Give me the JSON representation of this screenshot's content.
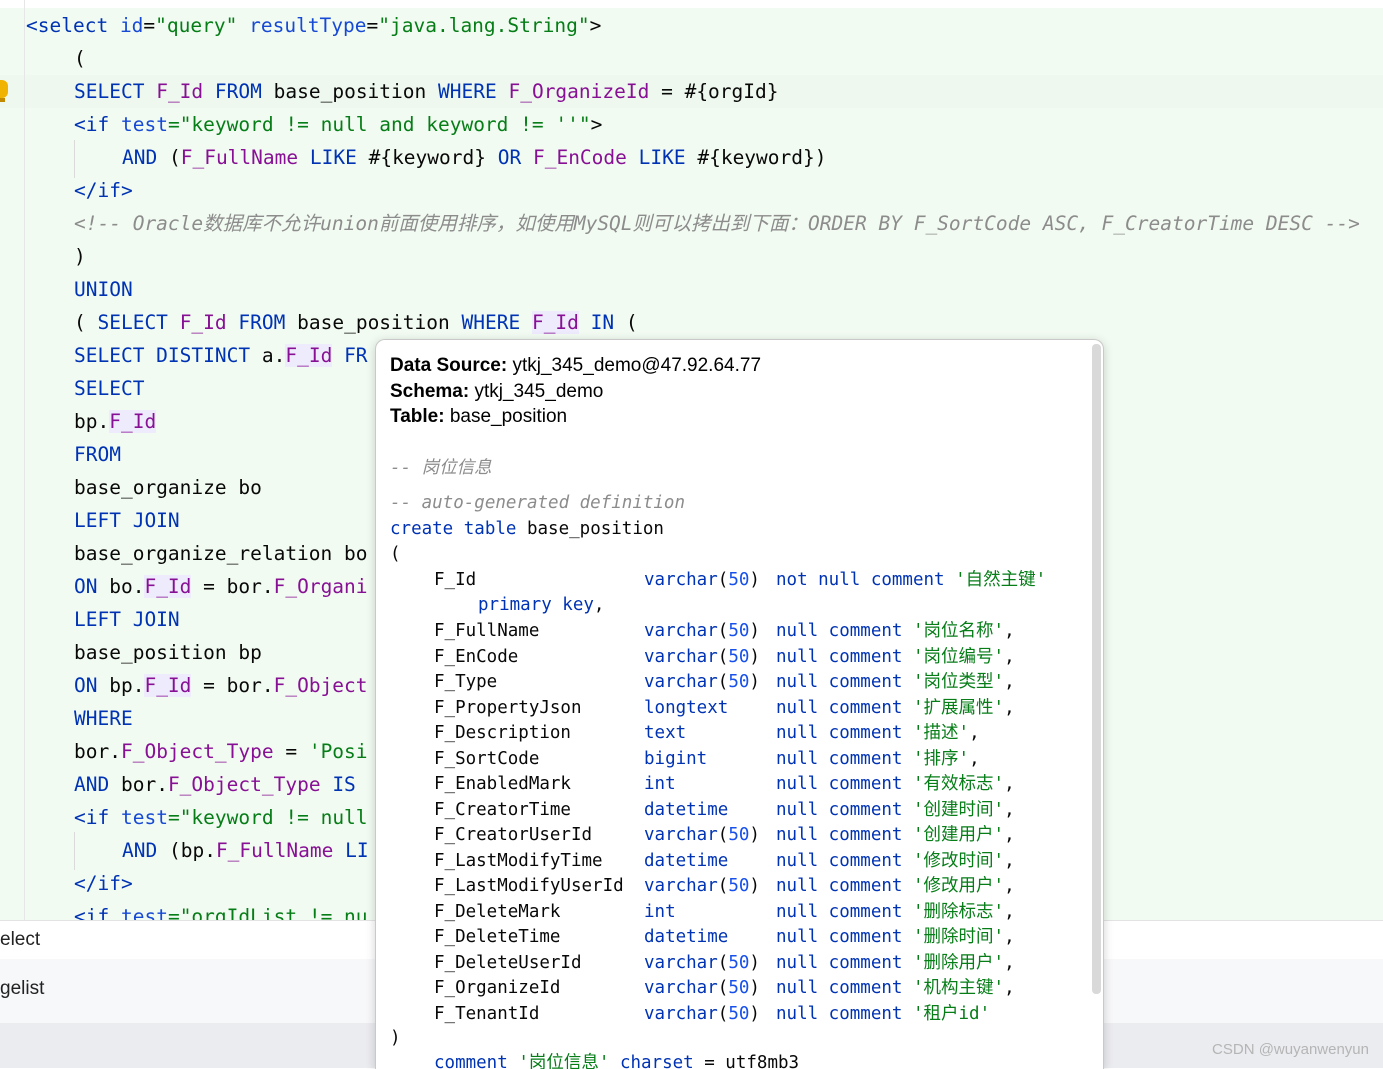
{
  "editor": {
    "line1": {
      "tag_open": "<select",
      "attr_id": "id",
      "val_id": "\"query\"",
      "attr_rt": "resultType",
      "val_rt": "\"java.lang.String\"",
      "tag_close": ">"
    },
    "line2": "(",
    "line3": {
      "kw1": "SELECT",
      "col1": "F_Id",
      "kw2": "FROM",
      "tbl": "base_position",
      "kw3": "WHERE",
      "col2": "F_OrganizeId",
      "rest": " = #{orgId}"
    },
    "line4": {
      "open": "<if",
      "attr": "test",
      "val": "=\"keyword != null and keyword != ''\"",
      "close": ">"
    },
    "line5": {
      "kw1": "AND",
      "p1": " (",
      "col1": "F_FullName",
      "kw2": "LIKE",
      "p2": " #{keyword} ",
      "kw3": "OR",
      "col2": "F_EnCode",
      "kw4": "LIKE",
      "p3": " #{keyword})"
    },
    "line6": "</if>",
    "line7": "<!-- Oracle数据库不允许union前面使用排序，如使用MySQL则可以拷出到下面：ORDER BY F_SortCode ASC, F_CreatorTime DESC -->",
    "line8": ")",
    "line9": "UNION",
    "line10": {
      "p1": "( ",
      "kw1": "SELECT",
      "col1": "F_Id",
      "kw2": "FROM",
      "tbl": "base_position",
      "kw3": "WHERE",
      "col2": "F_Id",
      "kw4": "IN",
      "p2": " ("
    },
    "line11": {
      "kw1": "SELECT DISTINCT",
      "p1": " a.",
      "col1": "F_Id",
      "kw2": "FR"
    },
    "line12": "SELECT",
    "line13": {
      "p1": "bp.",
      "col1": "F_Id"
    },
    "line14": "FROM",
    "line15": "base_organize bo",
    "line16": "LEFT JOIN",
    "line17": "base_organize_relation bo",
    "line18": {
      "kw1": "ON",
      "p1": " bo.",
      "col1": "F_Id",
      "p2": " = bor.",
      "col2": "F_Organi"
    },
    "line19": "LEFT JOIN",
    "line20": "base_position bp",
    "line21": {
      "kw1": "ON",
      "p1": " bp.",
      "col1": "F_Id",
      "p2": " = bor.",
      "col2": "F_Object"
    },
    "line22": "WHERE",
    "line23": {
      "p1": "bor.",
      "col1": "F_Object_Type",
      "p2": " = ",
      "str1": "'Posi"
    },
    "line24": {
      "kw1": "AND",
      "p1": " bor.",
      "col1": "F_Object_Type",
      "kw2": "IS"
    },
    "line25": {
      "open": "<if",
      "attr": "test",
      "val": "=\"keyword != null"
    },
    "line26": {
      "kw1": "AND",
      "p1": " (bp.",
      "col1": "F_FullName",
      "kw2": "LI"
    },
    "line27": "</if>",
    "line28": {
      "open": "<if",
      "attr": "test",
      "val": "=\"orgIdList != nu"
    }
  },
  "bottom_panel": {
    "row1": "elect",
    "row2": "gelist"
  },
  "watermark": "CSDN @wuyanwenyun",
  "popup": {
    "data_source_label": "Data Source:",
    "data_source_value": "ytkj_345_demo@47.92.64.77",
    "schema_label": "Schema:",
    "schema_value": "ytkj_345_demo",
    "table_label": "Table:",
    "table_value": "base_position",
    "comment1": "-- 岗位信息",
    "comment2": "-- auto-generated definition",
    "create_kw": "create table",
    "create_name": "base_position",
    "open_paren": "(",
    "close_paren": ")",
    "columns": [
      {
        "name": "F_Id",
        "type": "varchar",
        "len": "50",
        "mod": "not null comment",
        "cmt": "'自然主键'"
      },
      {
        "name": "F_FullName",
        "type": "varchar",
        "len": "50",
        "mod": "null comment",
        "cmt": "'岗位名称'"
      },
      {
        "name": "F_EnCode",
        "type": "varchar",
        "len": "50",
        "mod": "null comment",
        "cmt": "'岗位编号'"
      },
      {
        "name": "F_Type",
        "type": "varchar",
        "len": "50",
        "mod": "null comment",
        "cmt": "'岗位类型'"
      },
      {
        "name": "F_PropertyJson",
        "type": "longtext",
        "len": "",
        "mod": "null comment",
        "cmt": "'扩展属性'"
      },
      {
        "name": "F_Description",
        "type": "text",
        "len": "",
        "mod": "null comment",
        "cmt": "'描述'"
      },
      {
        "name": "F_SortCode",
        "type": "bigint",
        "len": "",
        "mod": "null comment",
        "cmt": "'排序'"
      },
      {
        "name": "F_EnabledMark",
        "type": "int",
        "len": "",
        "mod": "null comment",
        "cmt": "'有效标志'"
      },
      {
        "name": "F_CreatorTime",
        "type": "datetime",
        "len": "",
        "mod": "null comment",
        "cmt": "'创建时间'"
      },
      {
        "name": "F_CreatorUserId",
        "type": "varchar",
        "len": "50",
        "mod": "null comment",
        "cmt": "'创建用户'"
      },
      {
        "name": "F_LastModifyTime",
        "type": "datetime",
        "len": "",
        "mod": "null comment",
        "cmt": "'修改时间'"
      },
      {
        "name": "F_LastModifyUserId",
        "type": "varchar",
        "len": "50",
        "mod": "null comment",
        "cmt": "'修改用户'"
      },
      {
        "name": "F_DeleteMark",
        "type": "int",
        "len": "",
        "mod": "null comment",
        "cmt": "'删除标志'"
      },
      {
        "name": "F_DeleteTime",
        "type": "datetime",
        "len": "",
        "mod": "null comment",
        "cmt": "'删除时间'"
      },
      {
        "name": "F_DeleteUserId",
        "type": "varchar",
        "len": "50",
        "mod": "null comment",
        "cmt": "'删除用户'"
      },
      {
        "name": "F_OrganizeId",
        "type": "varchar",
        "len": "50",
        "mod": "null comment",
        "cmt": "'机构主键'"
      },
      {
        "name": "F_TenantId",
        "type": "varchar",
        "len": "50",
        "mod": "null comment",
        "cmt": "'租户id'"
      }
    ],
    "primary_key": "primary key",
    "footer_kw1": "comment",
    "footer_str": "'岗位信息'",
    "footer_kw2": "charset",
    "footer_rest": " = utf8mb3"
  }
}
